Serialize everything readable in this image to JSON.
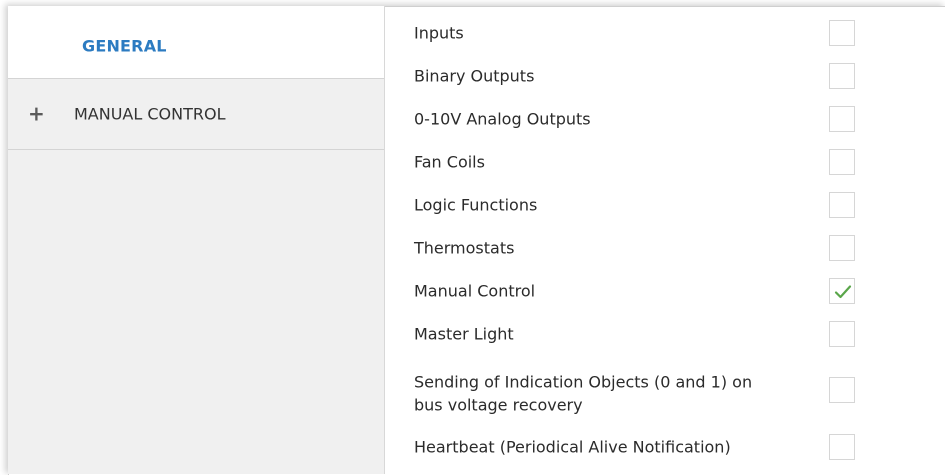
{
  "sidebar": {
    "tabs": [
      {
        "label": "GENERAL",
        "selected": true
      },
      {
        "label": "MANUAL CONTROL",
        "expand_icon": "plus-icon",
        "selected": false
      }
    ]
  },
  "settings": {
    "rows": [
      {
        "label": "Inputs",
        "checked": false
      },
      {
        "label": "Binary Outputs",
        "checked": false
      },
      {
        "label": "0-10V Analog Outputs",
        "checked": false
      },
      {
        "label": "Fan Coils",
        "checked": false
      },
      {
        "label": "Logic Functions",
        "checked": false
      },
      {
        "label": "Thermostats",
        "checked": false
      },
      {
        "label": "Manual Control",
        "checked": true
      },
      {
        "label": "Master Light",
        "checked": false
      },
      {
        "label": "Sending of Indication Objects (0 and 1) on",
        "label_line2": "bus voltage recovery",
        "checked": false
      },
      {
        "label": "Heartbeat (Periodical Alive Notification)",
        "checked": false
      }
    ]
  },
  "colors": {
    "accent": "#2c7bc1",
    "checkmark": "#5aa64a",
    "sidebar_bg": "#f0f0f0"
  }
}
